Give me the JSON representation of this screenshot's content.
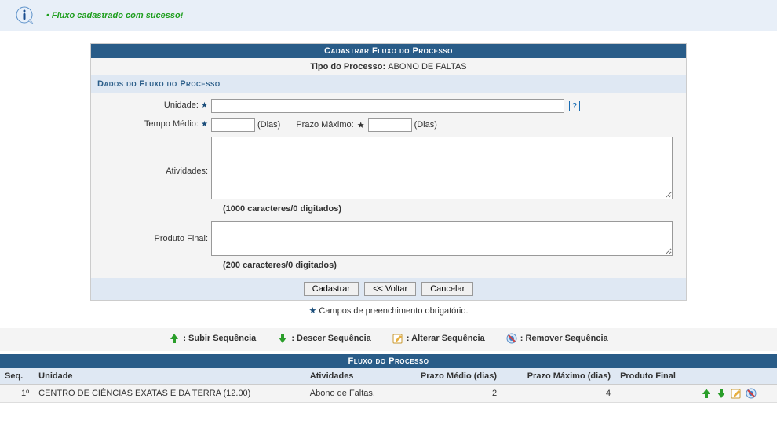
{
  "success": {
    "message": "• Fluxo cadastrado com sucesso!"
  },
  "form": {
    "header": "Cadastrar Fluxo do Processo",
    "tipo_label": "Tipo do Processo:",
    "tipo_value": "ABONO DE FALTAS",
    "section_header": "Dados do Fluxo do Processo",
    "labels": {
      "unidade": "Unidade:",
      "tempo_medio": "Tempo Médio:",
      "prazo_maximo": "Prazo Máximo:",
      "atividades": "Atividades:",
      "produto_final": "Produto Final:",
      "dias": "(Dias)",
      "star": "★"
    },
    "values": {
      "unidade": "",
      "tempo_medio": "",
      "prazo_maximo": "",
      "atividades": "",
      "produto_final": ""
    },
    "char_count_atividades": "(1000 caracteres/0 digitados)",
    "char_count_produto": "(200 caracteres/0 digitados)",
    "buttons": {
      "cadastrar": "Cadastrar",
      "voltar": "<< Voltar",
      "cancelar": "Cancelar"
    },
    "required_note": "Campos de preenchimento obrigatório.",
    "help": "?"
  },
  "legend": {
    "subir": ": Subir Sequência",
    "descer": ": Descer Sequência",
    "alterar": ": Alterar Sequência",
    "remover": ": Remover Sequência"
  },
  "table": {
    "header": "Fluxo do Processo",
    "columns": {
      "seq": "Seq.",
      "unidade": "Unidade",
      "atividades": "Atividades",
      "prazo_medio": "Prazo Médio (dias)",
      "prazo_maximo": "Prazo Máximo (dias)",
      "produto_final": "Produto Final"
    },
    "rows": [
      {
        "seq": "1º",
        "unidade": "CENTRO DE CIÊNCIAS EXATAS E DA TERRA (12.00)",
        "atividades": "Abono de Faltas.",
        "prazo_medio": "2",
        "prazo_maximo": "4",
        "produto_final": ""
      }
    ]
  }
}
